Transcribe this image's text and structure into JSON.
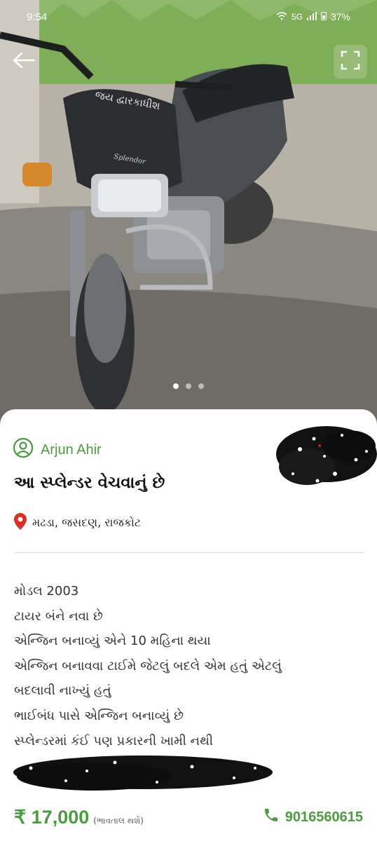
{
  "status_bar": {
    "time": "9:54",
    "network_label": "5G",
    "battery": "37%"
  },
  "photo": {
    "slide_count": 3,
    "active_slide": 1,
    "windscreen_text": "જય દ્વારકાધીશ",
    "badge_text": "Splendor"
  },
  "seller": {
    "name": "Arjun Ahir"
  },
  "listing": {
    "title": "આ સ્પ્લેન્ડર વેચવાનું છે",
    "location": "મઢડા, જસદણ, રાજકોટ",
    "description_lines": [
      "મોડલ 2003",
      "ટાયર બંને નવા છે",
      "એન્જિન બનાવ્યું એને 10 મહિના થયા",
      "એન્જિન બનાવવા ટાઈમે જેટલું બદલે એમ હતું એટલું",
      "બદલાવી નાખ્યું હતું",
      "ભાઈબંધ પાસે એન્જિન બનાવ્યું છે",
      "સ્પ્લેન્ડરમાં કંઈ પણ પ્રકારની ખામી નથી"
    ]
  },
  "footer": {
    "price": "₹ 17,000",
    "negotiable": "(ભાવતાલ થશે)",
    "phone": "9016560615"
  },
  "colors": {
    "accent_green": "#4a9c3e",
    "location_pin": "#d93025"
  },
  "icons": {
    "back": "arrow-left-icon",
    "fullscreen": "fullscreen-icon",
    "seller": "user-circle-icon",
    "location": "location-pin-icon",
    "phone": "phone-icon"
  }
}
